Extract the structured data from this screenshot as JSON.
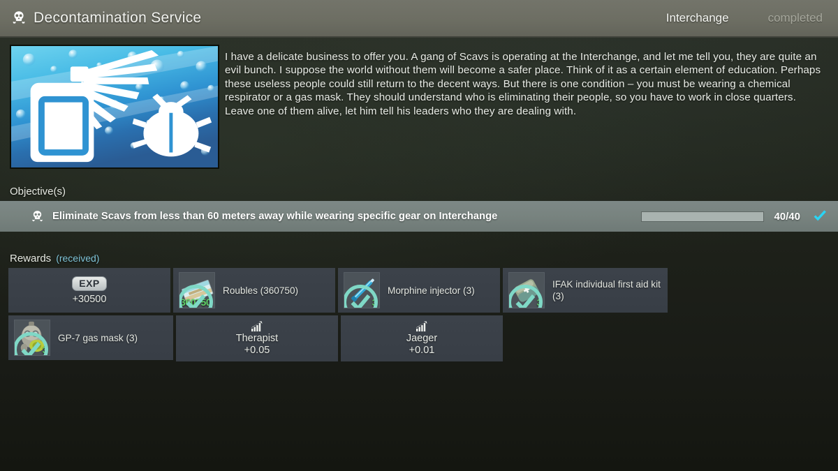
{
  "header": {
    "icon": "skull-icon",
    "title": "Decontamination Service",
    "location": "Interchange",
    "status": "completed"
  },
  "quest_image": {
    "icon": "spray-can-and-bug-image",
    "alt": "Spray can spraying at an insect over blue water droplets"
  },
  "description": "I have a delicate business to offer you. A gang of Scavs is operating at the Interchange, and let me tell you, they are quite an evil bunch. I suppose the world without them will become a safer place. Think of it as a certain element of education. Perhaps these useless people could still return to the decent ways. But there is one condition – you must be wearing a chemical respirator or a gas mask. They should understand who is eliminating their people, so you have to work in close quarters. Leave one of them alive, let him tell his leaders who they are dealing with.",
  "objectives": {
    "label": "Objective(s)",
    "items": [
      {
        "icon": "skull-icon",
        "text": "Eliminate Scavs from less than 60 meters away while wearing specific gear on Interchange",
        "progress_current": 40,
        "progress_total": 40,
        "progress_text": "40/40",
        "progress_percent": 100,
        "completed": true,
        "check_icon": "checkmark-icon"
      }
    ]
  },
  "rewards": {
    "label": "Rewards",
    "status": "(received)",
    "experience": {
      "badge": "EXP",
      "value": "+30500"
    },
    "items": [
      {
        "icon": "roubles-icon",
        "name": "Roubles (360750)",
        "count": "360750",
        "count_style": "money",
        "found_in_raid": true
      },
      {
        "icon": "morphine-injector-icon",
        "name": "Morphine injector (3)",
        "count": "3",
        "count_style": "corner",
        "found_in_raid": true
      },
      {
        "icon": "ifak-medkit-icon",
        "name": "IFAK individual first aid kit (3)",
        "count": "3",
        "count_style": "corner",
        "found_in_raid": true
      },
      {
        "icon": "gas-mask-icon",
        "name": "GP-7 gas mask (3)",
        "count": "3",
        "count_style": "corner",
        "found_in_raid": true
      }
    ],
    "traders": [
      {
        "icon": "reputation-bars-icon",
        "name": "Therapist",
        "value": "+0.05"
      },
      {
        "icon": "reputation-bars-icon",
        "name": "Jaeger",
        "value": "+0.01"
      }
    ]
  },
  "colors": {
    "header_bg": "#6d6e63",
    "objective_bg": "#78837f",
    "card_bg": "#3a4048",
    "accent_cyan": "#7fc4d8",
    "count_green": "#5fd267",
    "text_primary": "#e9ece6"
  }
}
